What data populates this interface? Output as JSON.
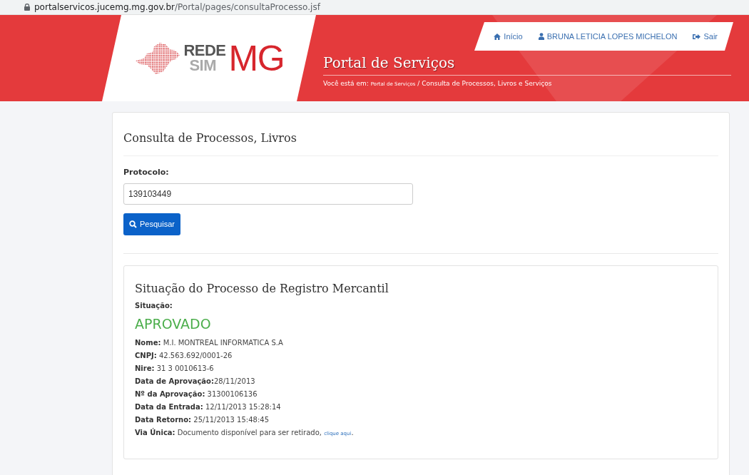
{
  "address_bar": {
    "url_host": "portalservicos.jucemg.mg.gov.br",
    "url_path": "/Portal/pages/consultaProcesso.jsf"
  },
  "header": {
    "logo": {
      "line_1": "REDE",
      "line_2": "SIM",
      "mark": "MG"
    },
    "nav": [
      {
        "kind": "home",
        "label": "Início"
      },
      {
        "kind": "user",
        "label": "BRUNA LETICIA LOPES MICHELON"
      },
      {
        "kind": "logout",
        "label": "Sair"
      }
    ],
    "title": "Portal de Serviços",
    "breadcrumb": {
      "prefix": "Você está em:",
      "link": "Portal de Serviços",
      "rest": "/ Consulta de Processos, Livros e Serviços"
    }
  },
  "search": {
    "title": "Consulta de Processos, Livros",
    "label": "Protocolo:",
    "value": "139103449",
    "button": "Pesquisar"
  },
  "result": {
    "title": "Situação do Processo de Registro Mercantil",
    "status_label": "Situação:",
    "status": "APROVADO",
    "fields": [
      {
        "text": "**Nome:** M.I. MONTREAL INFORMATICA S.A"
      },
      {
        "text": "**CNPJ:** 42.563.692/0001-26"
      },
      {
        "text": "**Nire:** 31 3 0010613-6"
      },
      {
        "text": "**Data de Aprovação:**28/11/2013"
      },
      {
        "text": "**Nº da Aprovação:** 31300106136"
      },
      {
        "text": "**Data da Entrada:** 12/11/2013 15:28:14"
      },
      {
        "text": "**Data Retorno:** 25/11/2013 15:48:45"
      },
      {
        "text": "**Via Única:** Documento disponível para ser retirado,",
        "link": "clique aqui",
        "after": "."
      }
    ]
  }
}
